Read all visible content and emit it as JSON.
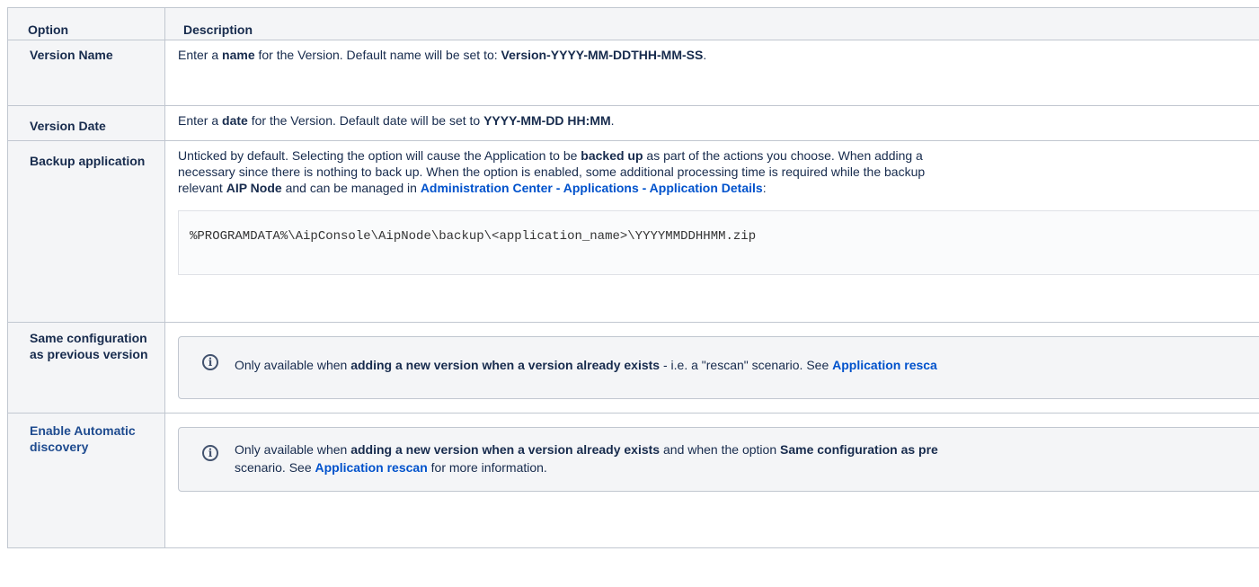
{
  "table": {
    "headers": {
      "option": "Option",
      "description": "Description"
    },
    "rows": {
      "version_name": {
        "option": "Version Name",
        "desc": {
          "p1": "Enter a ",
          "b1": "name",
          "p2": " for the Version. Default name will be set to: ",
          "b2": "Version-YYYY-MM-DDTHH-MM-SS",
          "p3": "."
        }
      },
      "version_date": {
        "option": "Version Date",
        "desc": {
          "p1": "Enter a ",
          "b1": "date",
          "p2": " for the Version. Default date will be set to ",
          "b2": "YYYY-MM-DD HH:MM",
          "p3": "."
        }
      },
      "backup_application": {
        "option": "Backup application",
        "desc": {
          "line1_p1": "Unticked by default. Selecting the option will cause the Application to be ",
          "line1_b1": "backed up",
          "line1_p2": " as part of the actions you choose. When adding a",
          "line2": "necessary since there is nothing to back up. When the option is enabled, some additional processing time is required while the backup",
          "line3_p1": "relevant ",
          "line3_b1": "AIP Node",
          "line3_p2": " and can be managed in ",
          "line3_link": "Administration Center - Applications - Application Details",
          "line3_p3": ":"
        },
        "code": "%PROGRAMDATA%\\AipConsole\\AipNode\\backup\\<application_name>\\YYYYMMDDHHMM.zip"
      },
      "same_configuration": {
        "option": "Same configuration as previous version",
        "info": {
          "p1": "Only available when ",
          "b1": "adding a new version when a version already exists",
          "p2": " - i.e. a \"rescan\" scenario. See ",
          "link": "Application resca"
        }
      },
      "enable_discovery": {
        "option": "Enable Automatic discovery",
        "info": {
          "line1_p1": "Only available when ",
          "line1_b1": "adding a new version when a version already exists",
          "line1_p2": " and when the option ",
          "line1_b2": "Same configuration as pre",
          "line2_p1": "scenario. See ",
          "line2_link": "Application rescan",
          "line2_p2": " for more information."
        }
      }
    }
  },
  "icons": {
    "info": "info-circle-icon"
  },
  "colors": {
    "link": "#0052cc",
    "option_link": "#1e4b8f",
    "header_bg": "#f4f5f7",
    "border": "#c1c7d0",
    "text": "#172b4d"
  }
}
